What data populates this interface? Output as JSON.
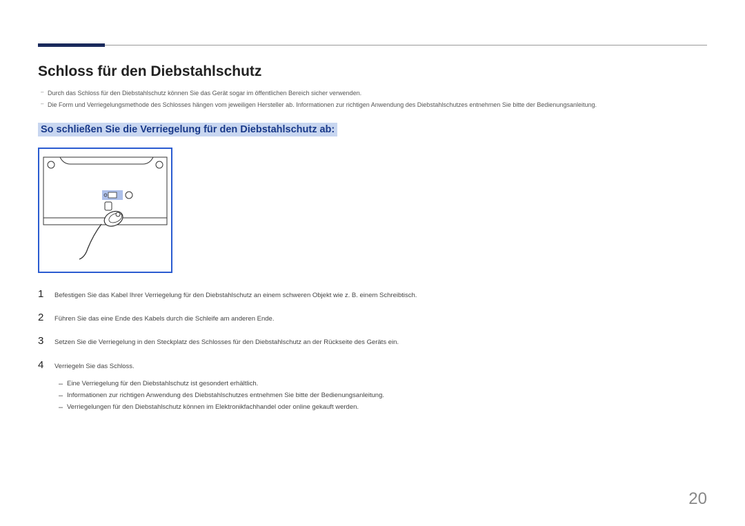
{
  "heading": "Schloss für den Diebstahlschutz",
  "intro_bullets": [
    "Durch das Schloss für den Diebstahlschutz können Sie das Gerät sogar im öffentlichen Bereich sicher verwenden.",
    "Die Form und Verriegelungsmethode des Schlosses hängen vom jeweiligen Hersteller ab. Informationen zur richtigen Anwendung des Diebstahlschutzes entnehmen Sie bitte der Bedienungsanleitung."
  ],
  "subheading": "So schließen Sie die Verriegelung für den Diebstahlschutz ab:",
  "steps": [
    {
      "num": "1",
      "text": "Befestigen Sie das Kabel Ihrer Verriegelung für den Diebstahlschutz an einem schweren Objekt wie z. B. einem Schreibtisch."
    },
    {
      "num": "2",
      "text": "Führen Sie das eine Ende des Kabels durch die Schleife am anderen Ende."
    },
    {
      "num": "3",
      "text": "Setzen Sie die Verriegelung in den Steckplatz des Schlosses für den Diebstahlschutz an der Rückseite des Geräts ein."
    },
    {
      "num": "4",
      "text": "Verriegeln Sie das Schloss."
    }
  ],
  "notes": [
    "Eine Verriegelung für den Diebstahlschutz ist gesondert erhältlich.",
    "Informationen zur richtigen Anwendung des Diebstahlschutzes entnehmen Sie bitte der Bedienungsanleitung.",
    "Verriegelungen für den Diebstahlschutz können im Elektronikfachhandel oder online gekauft werden."
  ],
  "page_number": "20"
}
